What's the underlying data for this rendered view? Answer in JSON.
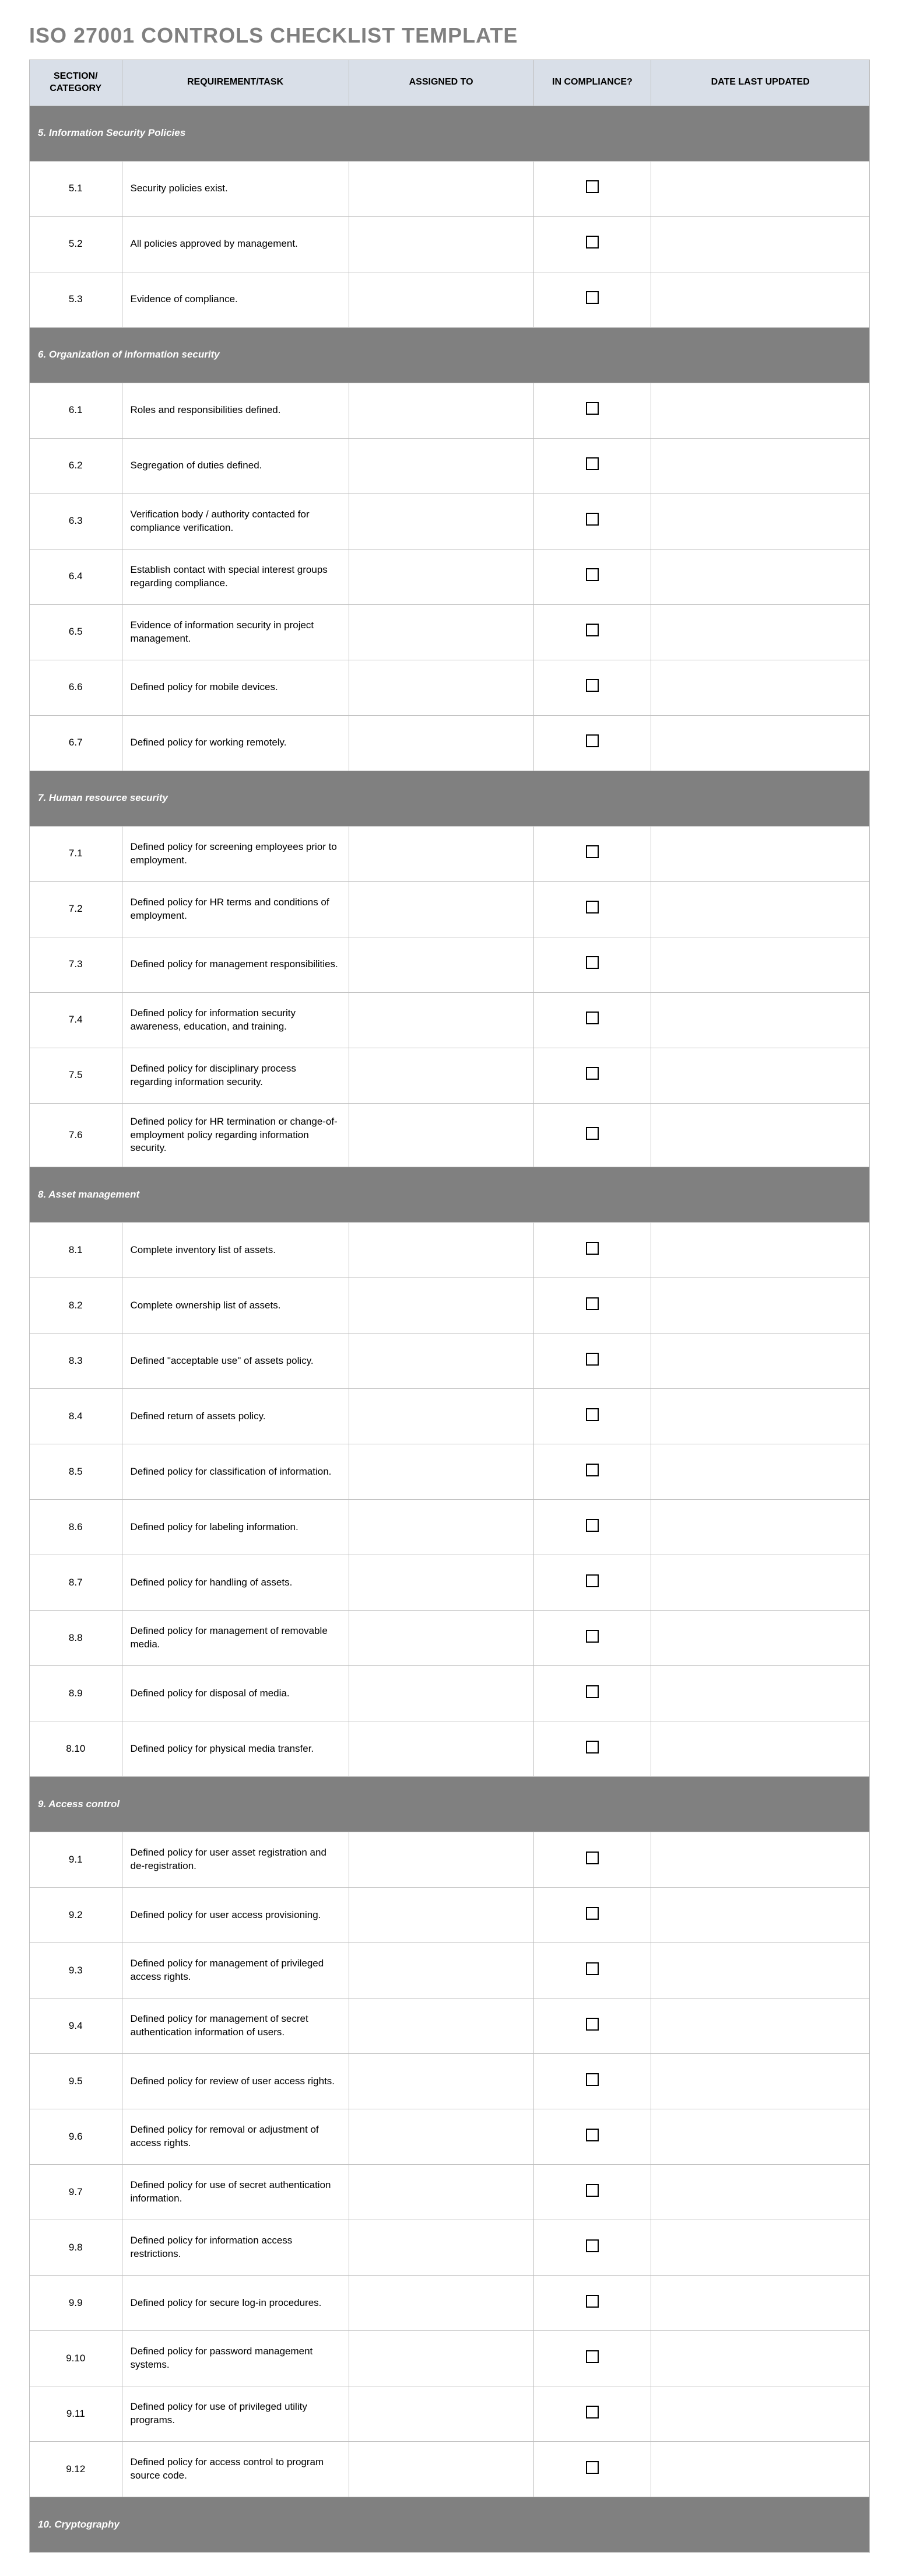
{
  "title": "ISO 27001 CONTROLS CHECKLIST TEMPLATE",
  "headers": {
    "section": "SECTION/ CATEGORY",
    "requirement": "REQUIREMENT/TASK",
    "assigned": "ASSIGNED TO",
    "compliance": "IN COMPLIANCE?",
    "date": "DATE LAST UPDATED"
  },
  "sections": [
    {
      "title": "5. Information Security Policies",
      "rows": [
        {
          "id": "5.1",
          "task": "Security policies exist.",
          "assigned": "",
          "date": ""
        },
        {
          "id": "5.2",
          "task": "All policies approved by management.",
          "assigned": "",
          "date": ""
        },
        {
          "id": "5.3",
          "task": "Evidence of compliance.",
          "assigned": "",
          "date": ""
        }
      ]
    },
    {
      "title": "6. Organization of information security",
      "rows": [
        {
          "id": "6.1",
          "task": "Roles and responsibilities defined.",
          "assigned": "",
          "date": ""
        },
        {
          "id": "6.2",
          "task": "Segregation of duties defined.",
          "assigned": "",
          "date": ""
        },
        {
          "id": "6.3",
          "task": "Verification body / authority contacted for compliance verification.",
          "assigned": "",
          "date": ""
        },
        {
          "id": "6.4",
          "task": "Establish contact with special interest groups regarding compliance.",
          "assigned": "",
          "date": ""
        },
        {
          "id": "6.5",
          "task": "Evidence of information security in project management.",
          "assigned": "",
          "date": ""
        },
        {
          "id": "6.6",
          "task": "Defined policy for mobile devices.",
          "assigned": "",
          "date": ""
        },
        {
          "id": "6.7",
          "task": "Defined policy for working remotely.",
          "assigned": "",
          "date": ""
        }
      ]
    },
    {
      "title": "7. Human resource security",
      "rows": [
        {
          "id": "7.1",
          "task": "Defined policy for screening employees prior to employment.",
          "assigned": "",
          "date": ""
        },
        {
          "id": "7.2",
          "task": "Defined policy for HR terms and conditions of employment.",
          "assigned": "",
          "date": ""
        },
        {
          "id": "7.3",
          "task": "Defined policy for management responsibilities.",
          "assigned": "",
          "date": ""
        },
        {
          "id": "7.4",
          "task": "Defined policy for information security awareness, education, and training.",
          "assigned": "",
          "date": ""
        },
        {
          "id": "7.5",
          "task": "Defined policy for disciplinary process regarding information security.",
          "assigned": "",
          "date": ""
        },
        {
          "id": "7.6",
          "task": "Defined policy for HR termination or change-of-employment policy regarding information security.",
          "assigned": "",
          "date": ""
        }
      ]
    },
    {
      "title": "8. Asset management",
      "rows": [
        {
          "id": "8.1",
          "task": "Complete inventory list of assets.",
          "assigned": "",
          "date": ""
        },
        {
          "id": "8.2",
          "task": "Complete ownership list of assets.",
          "assigned": "",
          "date": ""
        },
        {
          "id": "8.3",
          "task": "Defined \"acceptable use\" of assets policy.",
          "assigned": "",
          "date": ""
        },
        {
          "id": "8.4",
          "task": "Defined return of assets policy.",
          "assigned": "",
          "date": ""
        },
        {
          "id": "8.5",
          "task": "Defined policy for classification of information.",
          "assigned": "",
          "date": ""
        },
        {
          "id": "8.6",
          "task": "Defined policy for labeling information.",
          "assigned": "",
          "date": ""
        },
        {
          "id": "8.7",
          "task": "Defined policy for handling of assets.",
          "assigned": "",
          "date": ""
        },
        {
          "id": "8.8",
          "task": "Defined policy for management of removable media.",
          "assigned": "",
          "date": ""
        },
        {
          "id": "8.9",
          "task": "Defined policy for disposal of media.",
          "assigned": "",
          "date": ""
        },
        {
          "id": "8.10",
          "task": "Defined policy for physical media transfer.",
          "assigned": "",
          "date": ""
        }
      ]
    },
    {
      "title": "9. Access control",
      "rows": [
        {
          "id": "9.1",
          "task": "Defined policy for user asset registration and de-registration.",
          "assigned": "",
          "date": ""
        },
        {
          "id": "9.2",
          "task": "Defined policy for user access provisioning.",
          "assigned": "",
          "date": ""
        },
        {
          "id": "9.3",
          "task": "Defined policy for management of privileged access rights.",
          "assigned": "",
          "date": ""
        },
        {
          "id": "9.4",
          "task": "Defined policy for management of secret authentication information of users.",
          "assigned": "",
          "date": ""
        },
        {
          "id": "9.5",
          "task": "Defined policy for review of user access rights.",
          "assigned": "",
          "date": ""
        },
        {
          "id": "9.6",
          "task": "Defined policy for removal or adjustment of access rights.",
          "assigned": "",
          "date": ""
        },
        {
          "id": "9.7",
          "task": "Defined policy for use of secret authentication information.",
          "assigned": "",
          "date": ""
        },
        {
          "id": "9.8",
          "task": "Defined policy for information access restrictions.",
          "assigned": "",
          "date": ""
        },
        {
          "id": "9.9",
          "task": "Defined policy for secure log-in procedures.",
          "assigned": "",
          "date": ""
        },
        {
          "id": "9.10",
          "task": "Defined policy for password management systems.",
          "assigned": "",
          "date": ""
        },
        {
          "id": "9.11",
          "task": "Defined policy for use of privileged utility programs.",
          "assigned": "",
          "date": ""
        },
        {
          "id": "9.12",
          "task": "Defined policy for access control to program source code.",
          "assigned": "",
          "date": ""
        }
      ]
    },
    {
      "title": "10. Cryptography",
      "rows": []
    }
  ]
}
